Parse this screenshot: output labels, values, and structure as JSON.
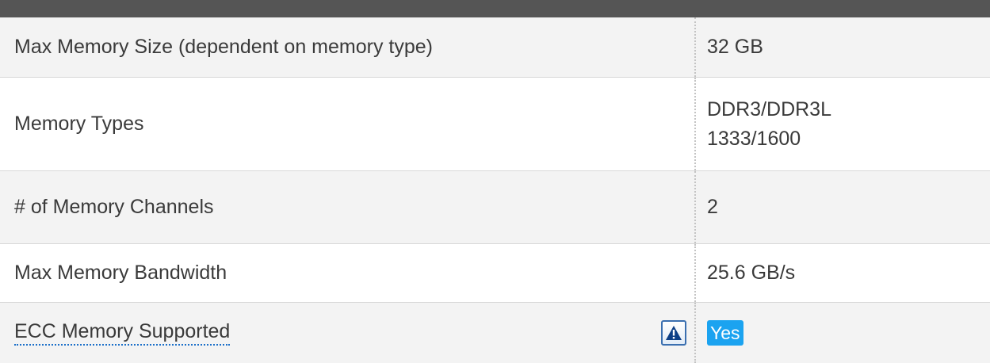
{
  "spec_rows": [
    {
      "label": "Max Memory Size (dependent on memory type)",
      "value": "32 GB"
    },
    {
      "label": "Memory Types",
      "value_lines": [
        "DDR3/DDR3L",
        "1333/1600"
      ]
    },
    {
      "label": "# of Memory Channels",
      "value": "2"
    },
    {
      "label": "Max Memory Bandwidth",
      "value": "25.6 GB/s"
    },
    {
      "label": "ECC Memory Supported",
      "value": "Yes",
      "info_icon": "info-warning-icon"
    }
  ],
  "colors": {
    "header": "#555555",
    "row_alt": "#f3f3f3",
    "badge": "#1ba3f0",
    "link_underline": "#1a6fc9"
  }
}
